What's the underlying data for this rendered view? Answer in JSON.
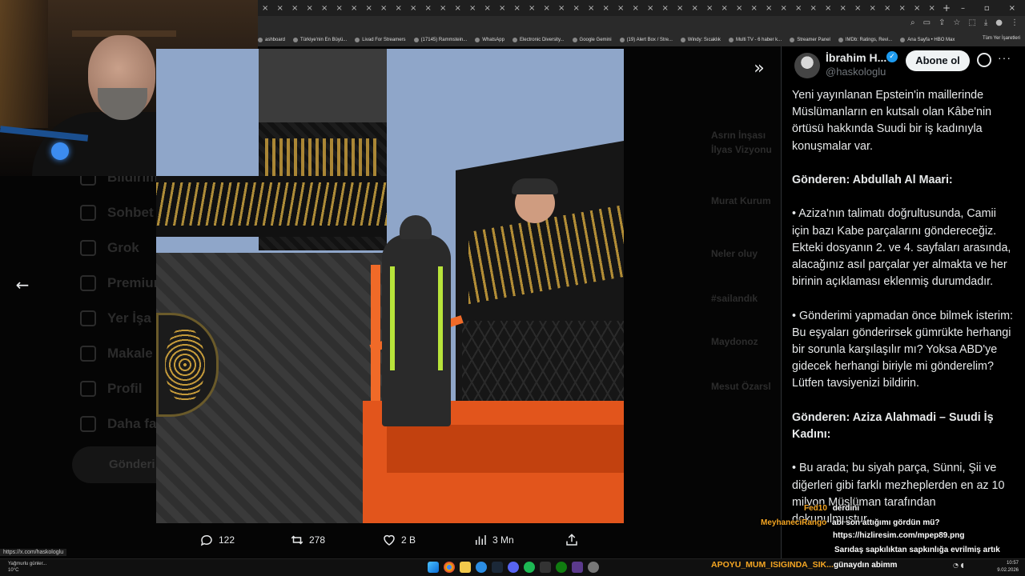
{
  "browser": {
    "tab_count": 46,
    "new_tab": "+",
    "window_controls": [
      "–",
      "▫",
      "×"
    ],
    "bookmarks": [
      "ashboard",
      "Türkiye'nin En Büyü...",
      "Livad For Streamers",
      "(17145) Rammstein...",
      "WhatsApp",
      "Electronic Diversity...",
      "Google Gemini",
      "(19) Alert Box / Stre...",
      "Windy: Sıcaklık",
      "Multi TV - 6 haber k...",
      "Streamer Panel",
      "IMDb: Ratings, Revi...",
      "Ana Sayfa • HBO Max"
    ],
    "bookmarks_other": "Tüm Yer İşaretleri",
    "status_url": "https://x.com/haskologlu"
  },
  "background_nav": [
    "Bildirim",
    "Sohbet",
    "Grok",
    "Premium",
    "Yer İşa",
    "Makale",
    "Profil",
    "Daha fa"
  ],
  "background_post_button": "Gönderi",
  "background_right": [
    "Asrın İnşası",
    "İlyas Vizyonu",
    "Murat Kurum",
    "Neler oluy",
    "#sailandık",
    "Maydonoz",
    "Mesut Özarsl"
  ],
  "viewer": {
    "next_icon": "»",
    "back_icon": "←"
  },
  "actions": {
    "replies": "122",
    "reposts": "278",
    "likes": "2 B",
    "views": "3 Mn"
  },
  "tweet": {
    "name": "İbrahim H...",
    "verified_icon": "✓",
    "handle": "@haskologlu",
    "follow_label": "Abone ol",
    "more": "···",
    "paragraphs": [
      "Yeni yayınlanan Epstein'in maillerinde Müslümanların en kutsalı olan Kâbe'nin örtüsü hakkında Suudi bir iş kadınıyla konuşmalar var.",
      "Gönderen: Abdullah Al Maari:",
      "• Aziza'nın talimatı doğrultusunda, Camii için bazı Kabe parçalarını göndereceğiz. Ekteki dosyanın 2. ve 4. sayfaları arasında, alacağınız asıl parçalar yer almakta ve her birinin açıklaması eklenmiş durumdadır.",
      "• Gönderimi yapmadan önce bilmek isterim: Bu eşyaları gönderirsek gümrükte herhangi bir sorunla karşılaşılır mı? Yoksa ABD'ye gidecek herhangi biriyle mi gönderelim? Lütfen tavsiyenizi bildirin.",
      "Gönderen: Aziza Alahmadi – Suudi İş Kadını:",
      "• Bu arada; bu siyah parça, Sünni, Şii ve diğerleri gibi farklı mezheplerden en az 10 milyon Müslüman tarafından dokunulmuştur."
    ]
  },
  "chat": [
    {
      "user": "Fed10",
      "msg": "derdini",
      "color": "#f5a623"
    },
    {
      "user": "MeyhaneciRango",
      "msg": "abi son attığımı gördün mü?",
      "color": "#f5a623"
    },
    {
      "user": "",
      "msg": "https://hizliresim.com/mpep89.png",
      "color": "#ffffff"
    },
    {
      "user": "",
      "msg": "Sarıdaş sapkılıktan sapkınlığa evrilmiş artık",
      "color": "#ffffff"
    }
  ],
  "taskbar": {
    "weather_title": "Yağmurlu günler...",
    "weather_temp": "10°C",
    "marquee": "APOYU_MUM_ISIGINDA_SIK...",
    "marquee_msg": "günaydın abimm",
    "time": "10:57",
    "date": "9.02.2026"
  },
  "colors": {
    "accent": "#1d9bf0",
    "background": "#000000",
    "text": "#e7e9ea",
    "muted": "#71767b",
    "chat_user": "#f5a623"
  }
}
